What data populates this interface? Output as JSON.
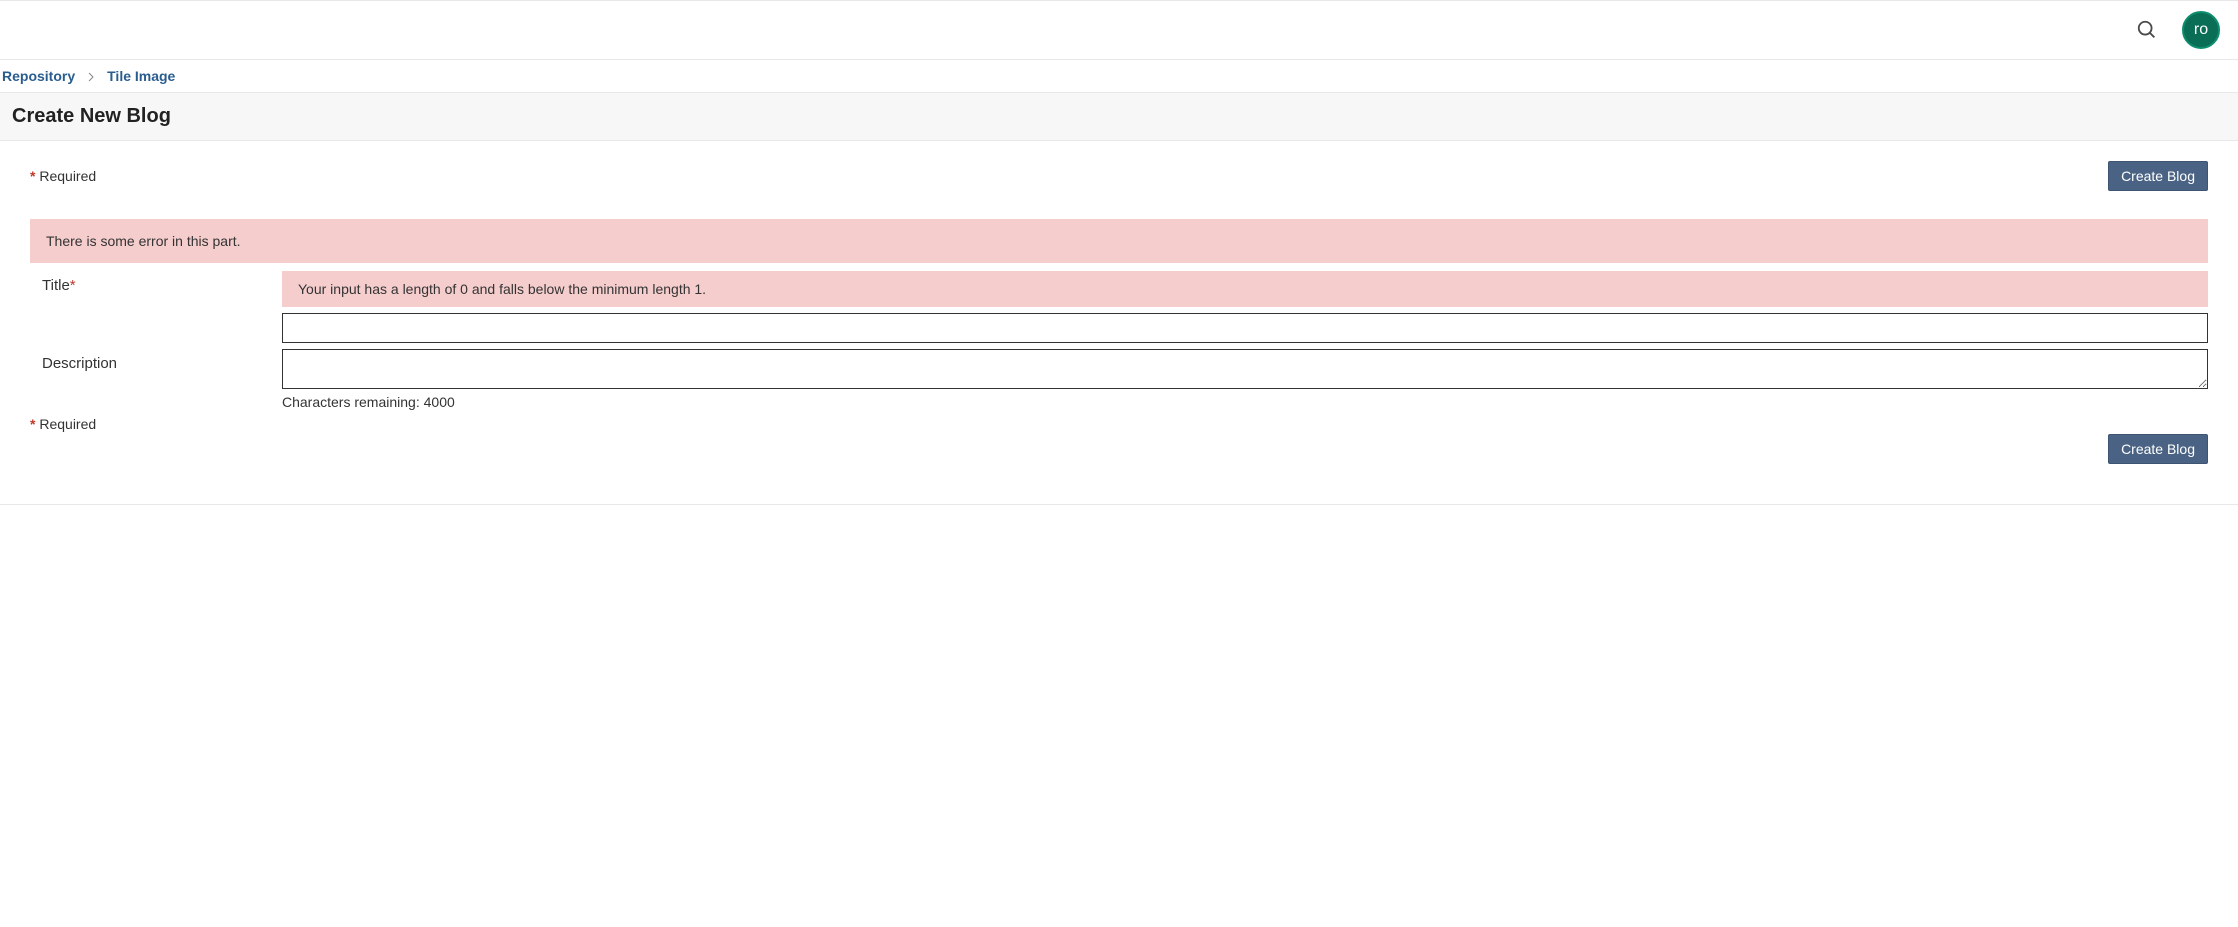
{
  "header": {
    "avatar_initials": "ro"
  },
  "breadcrumb": {
    "items": [
      {
        "label": "Repository"
      },
      {
        "label": "Tile Image"
      }
    ]
  },
  "page": {
    "title": "Create New Blog",
    "required_legend": "Required",
    "create_button_label": "Create Blog"
  },
  "form": {
    "section_error": "There is some error in this part.",
    "title": {
      "label": "Title",
      "error": "Your input has a length of 0 and falls below the minimum length 1.",
      "value": ""
    },
    "description": {
      "label": "Description",
      "value": "",
      "chars_remaining_prefix": "Characters remaining: ",
      "chars_remaining_value": "4000"
    }
  }
}
